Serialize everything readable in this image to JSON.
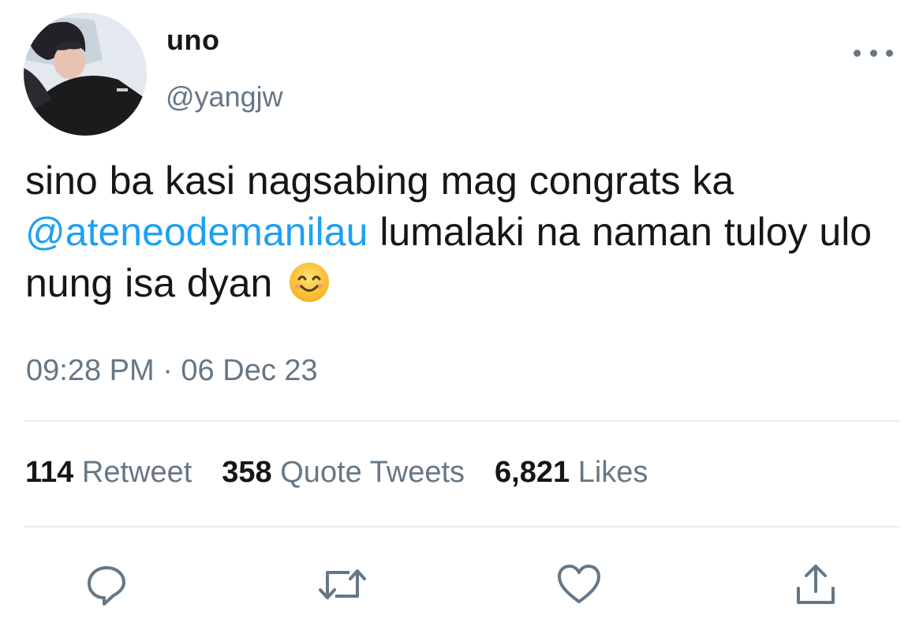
{
  "user": {
    "display_name": "uno",
    "handle": "@yangjw"
  },
  "tweet": {
    "text_before": "sino ba kasi nagsabing mag congrats ka",
    "mention": "@ateneodemanilau",
    "text_after": "lumalaki na naman tuloy ulo nung isa dyan",
    "emoji": "smiling-face-emoji",
    "timestamp": "09:28 PM · 06 Dec 23"
  },
  "stats": [
    {
      "count": "114",
      "label": "Retweet"
    },
    {
      "count": "358",
      "label": "Quote Tweets"
    },
    {
      "count": "6,821",
      "label": "Likes"
    }
  ],
  "actions": [
    {
      "icon": "reply-icon"
    },
    {
      "icon": "retweet-icon"
    },
    {
      "icon": "like-icon"
    },
    {
      "icon": "share-icon"
    }
  ],
  "colors": {
    "mention": "#1da1f2",
    "secondary_text": "#657786",
    "primary_text": "#14171a",
    "divider": "#e6ecf0"
  }
}
